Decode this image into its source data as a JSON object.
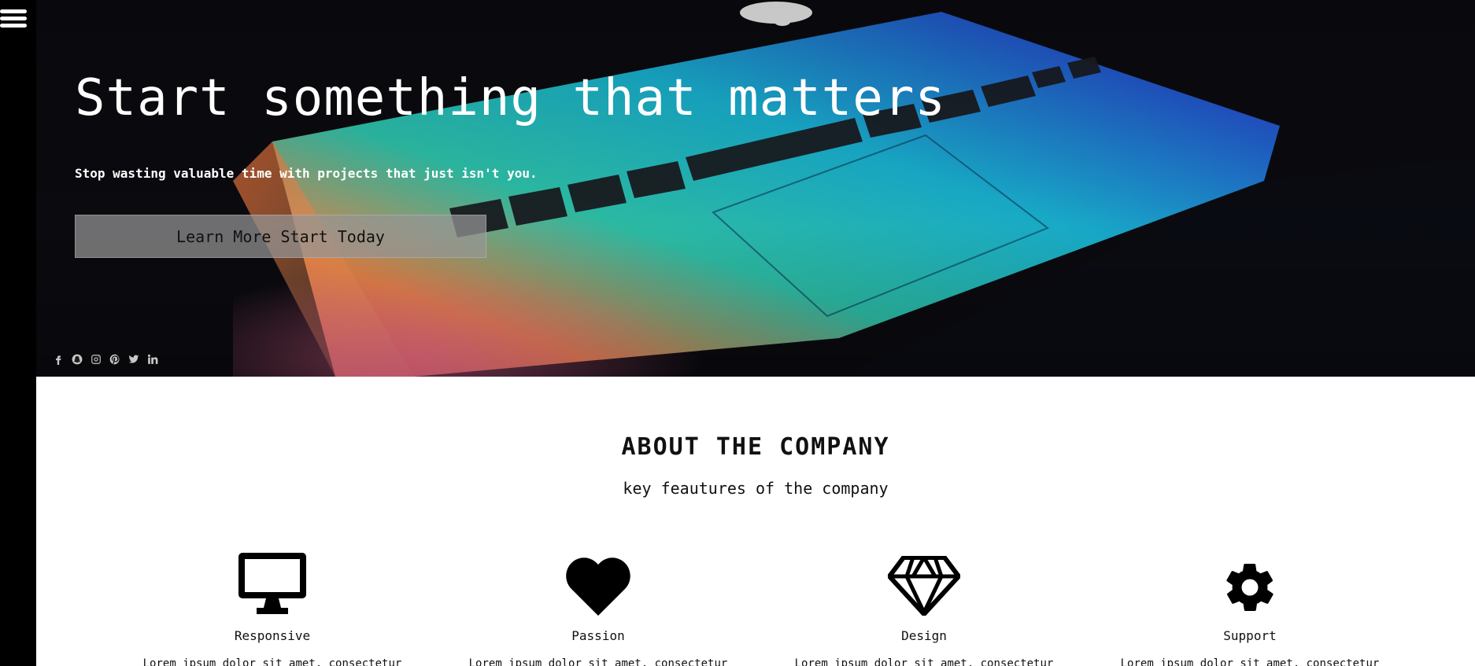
{
  "sidebar": {
    "menu_icon": "hamburger-menu-icon"
  },
  "hero": {
    "title": "Start something that matters",
    "subtitle": "Stop wasting valuable time with projects that just isn't you.",
    "cta_label": "Learn More Start Today",
    "socials": [
      "facebook-icon",
      "snapchat-icon",
      "instagram-icon",
      "pinterest-icon",
      "twitter-icon",
      "linkedin-icon"
    ]
  },
  "about": {
    "title": "ABOUT THE COMPANY",
    "subtitle": "key feautures of the company",
    "features": [
      {
        "icon": "desktop-icon",
        "label": "Responsive",
        "text": "Lorem ipsum dolor sit amet, consectetur"
      },
      {
        "icon": "heart-icon",
        "label": "Passion",
        "text": "Lorem ipsum dolor sit amet, consectetur"
      },
      {
        "icon": "diamond-icon",
        "label": "Design",
        "text": "Lorem ipsum dolor sit amet, consectetur"
      },
      {
        "icon": "gear-icon",
        "label": "Support",
        "text": "Lorem ipsum dolor sit amet, consectetur"
      }
    ]
  },
  "colors": {
    "sidebar": "#000000",
    "hero_bg": "#0c0c10",
    "cta_bg": "#969696",
    "text": "#111111"
  }
}
